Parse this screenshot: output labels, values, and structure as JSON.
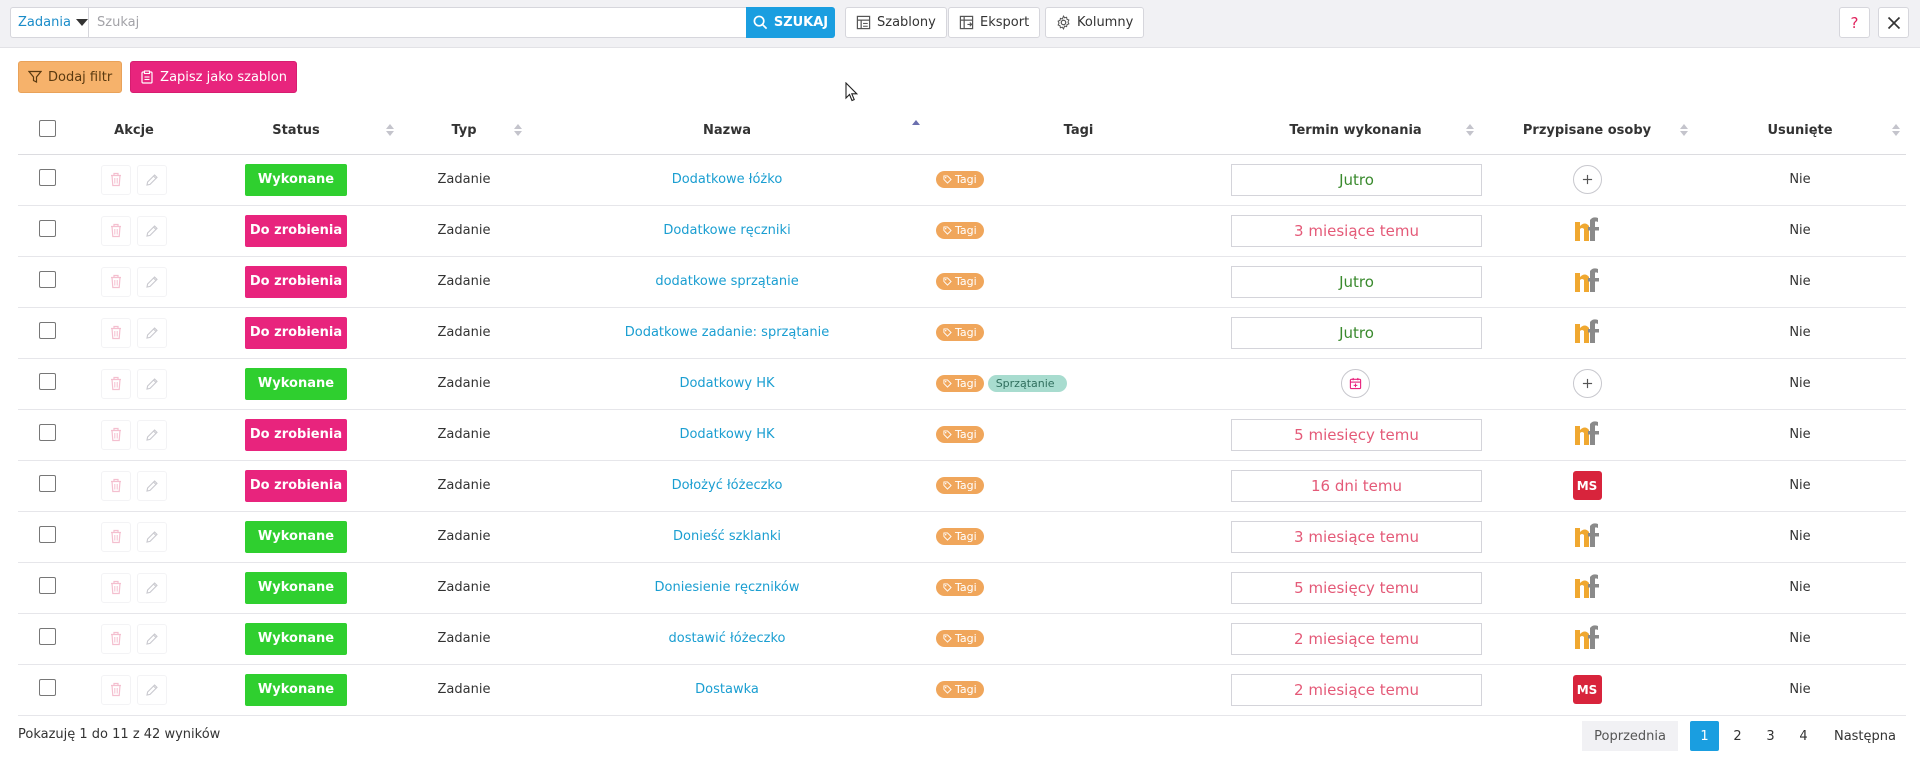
{
  "toolbar": {
    "entity_select": "Zadania",
    "search_placeholder": "Szukaj",
    "search_button": "SZUKAJ",
    "templates_label": "Szablony",
    "export_label": "Eksport",
    "columns_label": "Kolumny",
    "help_label": "?"
  },
  "filters": {
    "add_filter": "Dodaj filtr",
    "save_template": "Zapisz jako szablon"
  },
  "table": {
    "headers": {
      "actions": "Akcje",
      "status": "Status",
      "type": "Typ",
      "name": "Nazwa",
      "tags": "Tagi",
      "due": "Termin wykonania",
      "assigned": "Przypisane osoby",
      "deleted": "Usunięte"
    },
    "rows": [
      {
        "status": "Wykonane",
        "type": "Zadanie",
        "name": "Dodatkowe łóżko",
        "tags": [
          "Tagi"
        ],
        "due": "Jutro",
        "assignee": "add",
        "deleted": "Nie"
      },
      {
        "status": "Do zrobienia",
        "type": "Zadanie",
        "name": "Dodatkowe ręczniki",
        "tags": [
          "Tagi"
        ],
        "due": "3 miesiące temu",
        "assignee": "nf",
        "deleted": "Nie"
      },
      {
        "status": "Do zrobienia",
        "type": "Zadanie",
        "name": "dodatkowe sprzątanie",
        "tags": [
          "Tagi"
        ],
        "due": "Jutro",
        "assignee": "nf",
        "deleted": "Nie"
      },
      {
        "status": "Do zrobienia",
        "type": "Zadanie",
        "name": "Dodatkowe zadanie: sprzątanie",
        "tags": [
          "Tagi"
        ],
        "due": "Jutro",
        "assignee": "nf",
        "deleted": "Nie"
      },
      {
        "status": "Wykonane",
        "type": "Zadanie",
        "name": "Dodatkowy HK",
        "tags": [
          "Tagi",
          "Sprzątanie"
        ],
        "due": "",
        "assignee": "add",
        "deleted": "Nie"
      },
      {
        "status": "Do zrobienia",
        "type": "Zadanie",
        "name": "Dodatkowy HK",
        "tags": [
          "Tagi"
        ],
        "due": "5 miesięcy temu",
        "assignee": "nf",
        "deleted": "Nie"
      },
      {
        "status": "Do zrobienia",
        "type": "Zadanie",
        "name": "Dołożyć łóżeczko",
        "tags": [
          "Tagi"
        ],
        "due": "16 dni temu",
        "assignee": "MS",
        "deleted": "Nie"
      },
      {
        "status": "Wykonane",
        "type": "Zadanie",
        "name": "Donieść szklanki",
        "tags": [
          "Tagi"
        ],
        "due": "3 miesiące temu",
        "assignee": "nf",
        "deleted": "Nie"
      },
      {
        "status": "Wykonane",
        "type": "Zadanie",
        "name": "Doniesienie ręczników",
        "tags": [
          "Tagi"
        ],
        "due": "5 miesięcy temu",
        "assignee": "nf",
        "deleted": "Nie"
      },
      {
        "status": "Wykonane",
        "type": "Zadanie",
        "name": "dostawić łóżeczko",
        "tags": [
          "Tagi"
        ],
        "due": "2 miesiące temu",
        "assignee": "nf",
        "deleted": "Nie"
      },
      {
        "status": "Wykonane",
        "type": "Zadanie",
        "name": "Dostawka",
        "tags": [
          "Tagi"
        ],
        "due": "2 miesiące temu",
        "assignee": "MS",
        "deleted": "Nie"
      }
    ]
  },
  "footer": {
    "summary": "Pokazuję 1 do 11 z 42 wyników",
    "prev": "Poprzednia",
    "pages": [
      "1",
      "2",
      "3",
      "4"
    ],
    "next": "Następna"
  },
  "colors": {
    "done": "#2fcf2f",
    "todo": "#e8247d",
    "due_future": "#3a8a2e",
    "due_past": "#e45a78",
    "link": "#1a9ed1",
    "accent": "#1a9ee0"
  }
}
